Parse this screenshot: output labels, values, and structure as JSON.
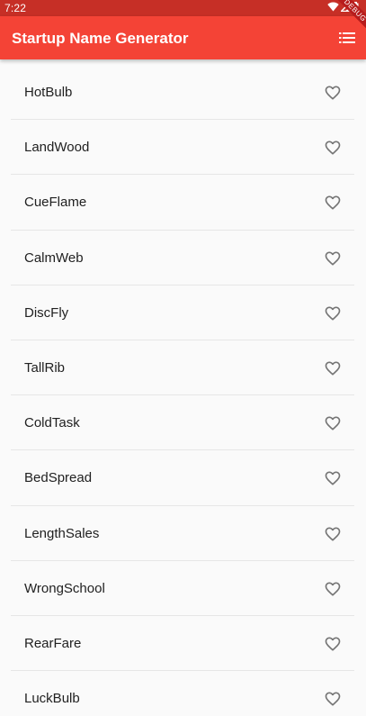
{
  "status_bar": {
    "time": "7:22",
    "background": "#c62f26",
    "icons": [
      "wifi-icon",
      "signal-icon",
      "battery-icon"
    ],
    "debug_label": "DEBUG"
  },
  "app_bar": {
    "title": "Startup Name Generator",
    "background": "#f44336",
    "action_icon": "list-icon"
  },
  "list": {
    "items": [
      {
        "name": "HotBulb",
        "saved": false
      },
      {
        "name": "LandWood",
        "saved": false
      },
      {
        "name": "CueFlame",
        "saved": false
      },
      {
        "name": "CalmWeb",
        "saved": false
      },
      {
        "name": "DiscFly",
        "saved": false
      },
      {
        "name": "TallRib",
        "saved": false
      },
      {
        "name": "ColdTask",
        "saved": false
      },
      {
        "name": "BedSpread",
        "saved": false
      },
      {
        "name": "LengthSales",
        "saved": false
      },
      {
        "name": "WrongSchool",
        "saved": false
      },
      {
        "name": "RearFare",
        "saved": false
      },
      {
        "name": "LuckBulb",
        "saved": false
      }
    ],
    "icon": "heart-outline-icon"
  }
}
